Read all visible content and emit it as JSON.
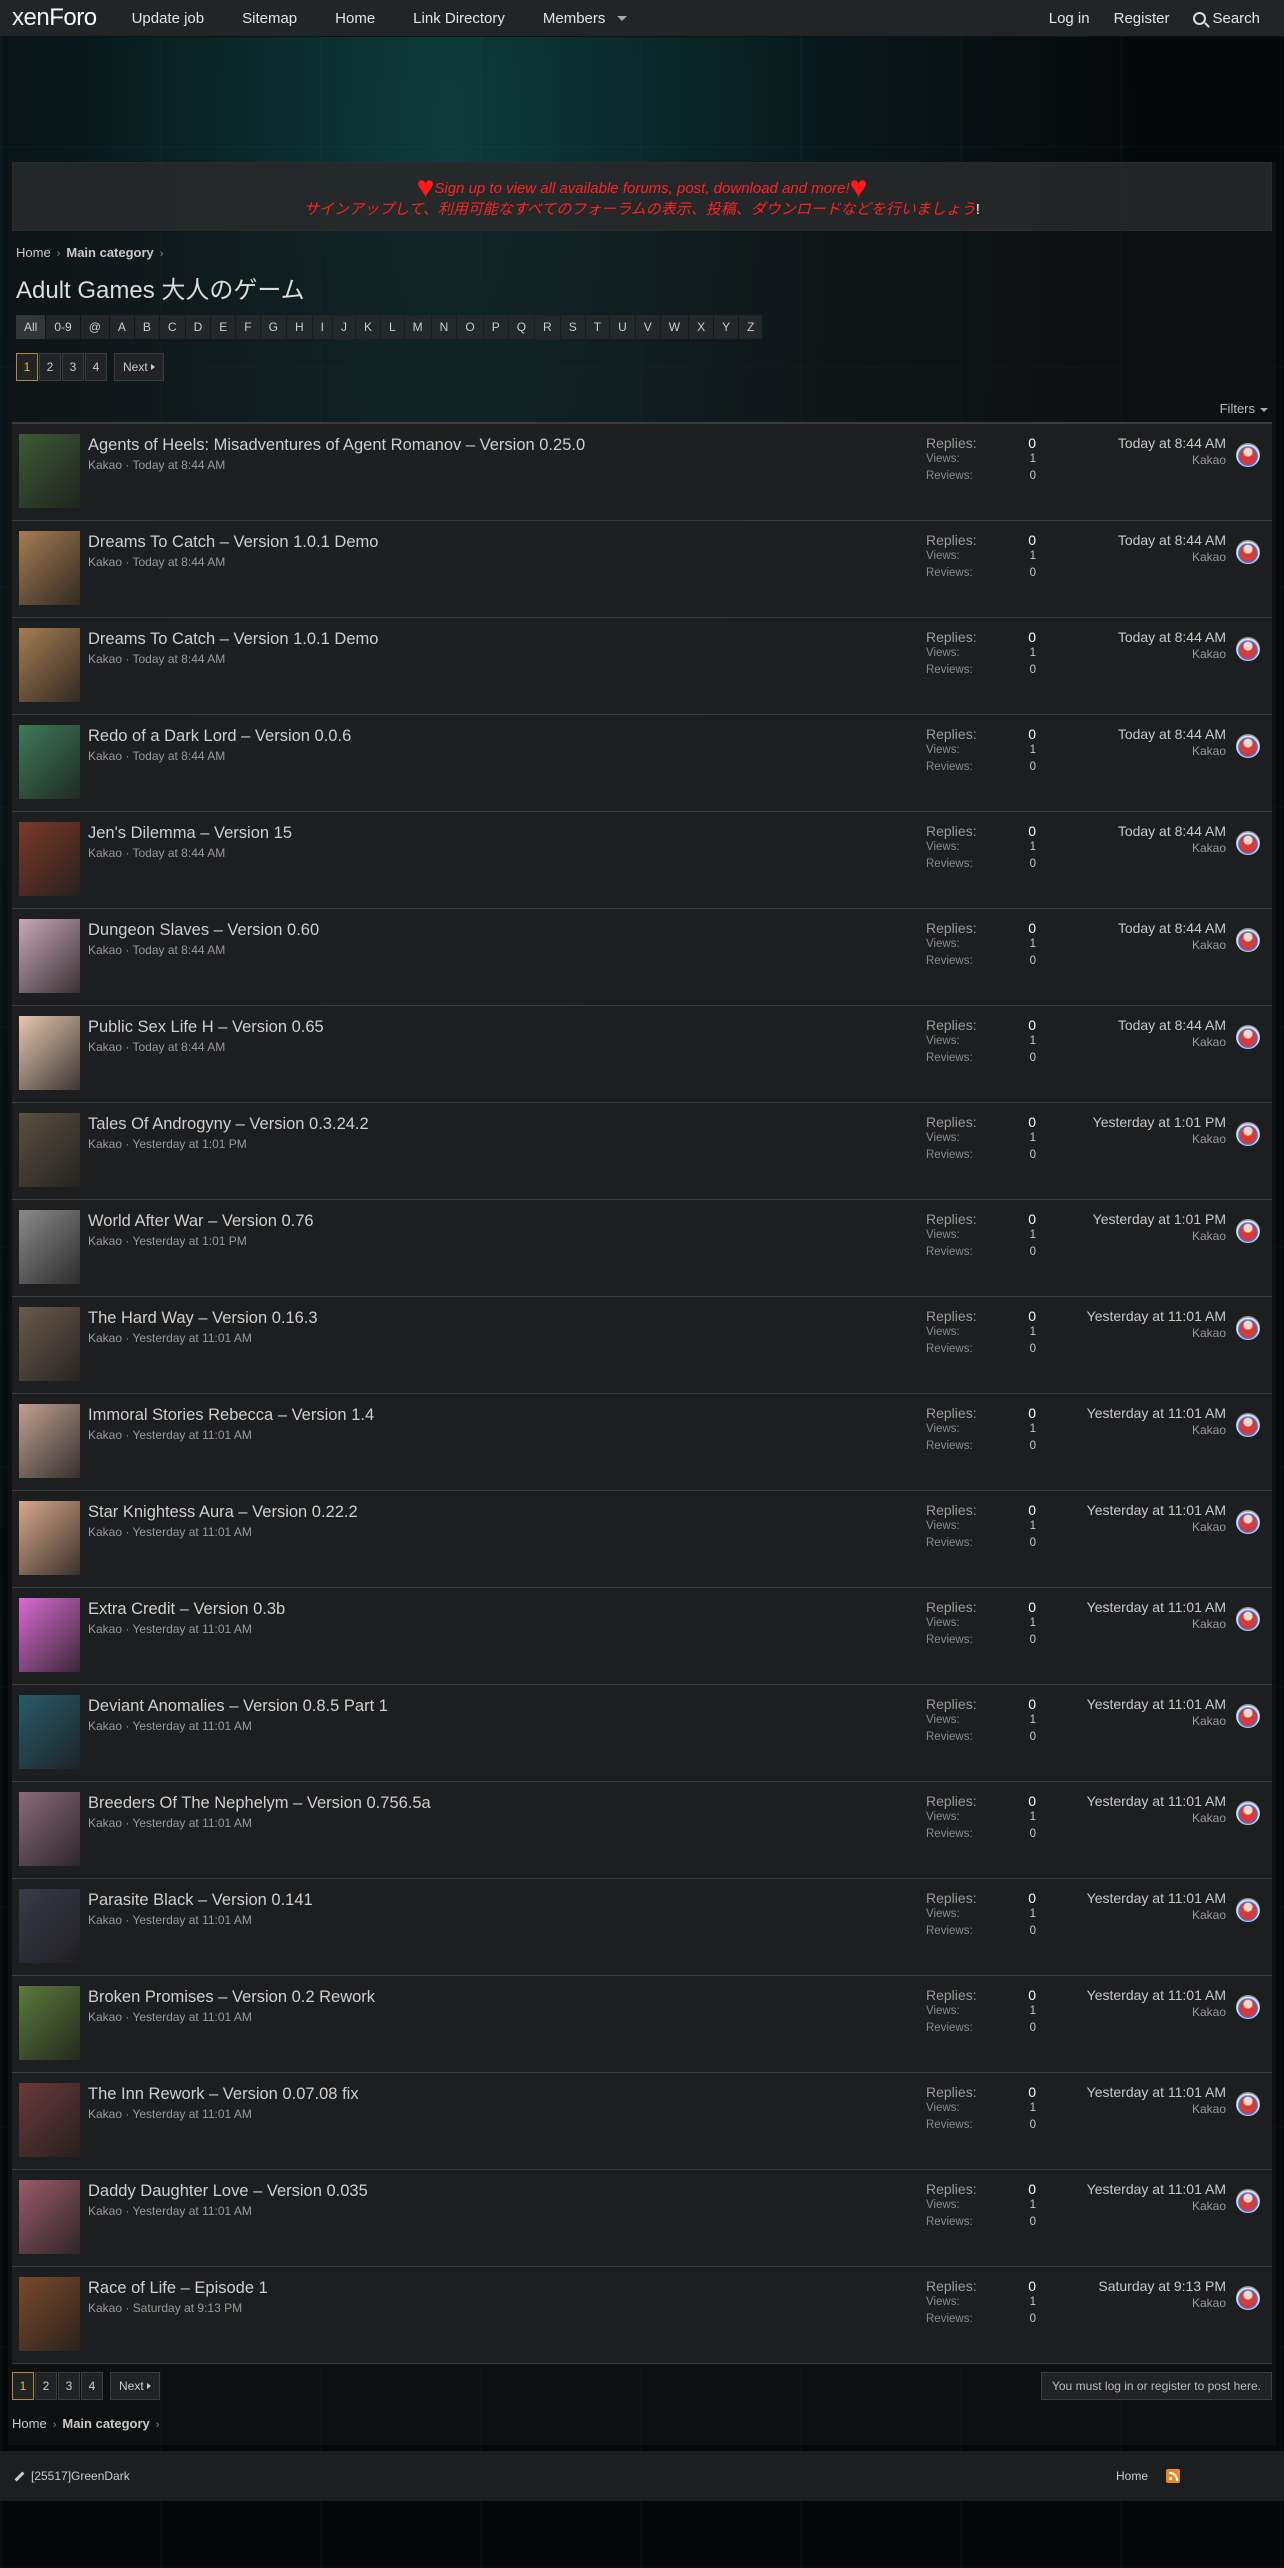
{
  "nav": {
    "logo_a": "xen",
    "logo_b": "Foro",
    "tabs": [
      "Update job",
      "Sitemap",
      "Home",
      "Link Directory",
      "Members"
    ],
    "login": "Log in",
    "register": "Register",
    "search": "Search"
  },
  "notice": {
    "line1": "Sign up to view all available forums, post, download and more!",
    "line2": "サインアップして、利用可能なすべてのフォーラムの表示、投稿、ダウンロードなどを行いましょう",
    "line2_end": "!"
  },
  "breadcrumb": {
    "home": "Home",
    "category": "Main category"
  },
  "page_title": "Adult Games 大人のゲーム",
  "letters": [
    "All",
    "0-9",
    "@",
    "A",
    "B",
    "C",
    "D",
    "E",
    "F",
    "G",
    "H",
    "I",
    "J",
    "K",
    "L",
    "M",
    "N",
    "O",
    "P",
    "Q",
    "R",
    "S",
    "T",
    "U",
    "V",
    "W",
    "X",
    "Y",
    "Z"
  ],
  "pager": {
    "pages": [
      "1",
      "2",
      "3",
      "4"
    ],
    "next": "Next"
  },
  "filters": "Filters",
  "stat_labels": {
    "replies": "Replies:",
    "views": "Views:",
    "reviews": "Reviews:"
  },
  "threads": [
    {
      "title": "Agents of Heels: Misadventures of Agent Romanov – Version 0.25.0",
      "author": "Kakao",
      "date": "Today at 8:44 AM",
      "replies": "0",
      "views": "1",
      "reviews": "0",
      "last_date": "Today at 8:44 AM",
      "last_user": "Kakao",
      "thumb_color": "#3c5a35"
    },
    {
      "title": "Dreams To Catch – Version 1.0.1 Demo",
      "author": "Kakao",
      "date": "Today at 8:44 AM",
      "replies": "0",
      "views": "1",
      "reviews": "0",
      "last_date": "Today at 8:44 AM",
      "last_user": "Kakao",
      "thumb_color": "#a67c52"
    },
    {
      "title": "Dreams To Catch – Version 1.0.1 Demo",
      "author": "Kakao",
      "date": "Today at 8:44 AM",
      "replies": "0",
      "views": "1",
      "reviews": "0",
      "last_date": "Today at 8:44 AM",
      "last_user": "Kakao",
      "thumb_color": "#a67c52"
    },
    {
      "title": "Redo of a Dark Lord – Version 0.0.6",
      "author": "Kakao",
      "date": "Today at 8:44 AM",
      "replies": "0",
      "views": "1",
      "reviews": "0",
      "last_date": "Today at 8:44 AM",
      "last_user": "Kakao",
      "thumb_color": "#3f7a5a"
    },
    {
      "title": "Jen's Dilemma – Version 15",
      "author": "Kakao",
      "date": "Today at 8:44 AM",
      "replies": "0",
      "views": "1",
      "reviews": "0",
      "last_date": "Today at 8:44 AM",
      "last_user": "Kakao",
      "thumb_color": "#7a3a2a"
    },
    {
      "title": "Dungeon Slaves – Version 0.60",
      "author": "Kakao",
      "date": "Today at 8:44 AM",
      "replies": "0",
      "views": "1",
      "reviews": "0",
      "last_date": "Today at 8:44 AM",
      "last_user": "Kakao",
      "thumb_color": "#c9a7b6"
    },
    {
      "title": "Public Sex Life H – Version 0.65",
      "author": "Kakao",
      "date": "Today at 8:44 AM",
      "replies": "0",
      "views": "1",
      "reviews": "0",
      "last_date": "Today at 8:44 AM",
      "last_user": "Kakao",
      "thumb_color": "#e6c6b0"
    },
    {
      "title": "Tales Of Androgyny – Version 0.3.24.2",
      "author": "Kakao",
      "date": "Yesterday at 1:01 PM",
      "replies": "0",
      "views": "1",
      "reviews": "0",
      "last_date": "Yesterday at 1:01 PM",
      "last_user": "Kakao",
      "thumb_color": "#5a5040"
    },
    {
      "title": "World After War – Version 0.76",
      "author": "Kakao",
      "date": "Yesterday at 1:01 PM",
      "replies": "0",
      "views": "1",
      "reviews": "0",
      "last_date": "Yesterday at 1:01 PM",
      "last_user": "Kakao",
      "thumb_color": "#8a8a8a"
    },
    {
      "title": "The Hard Way – Version 0.16.3",
      "author": "Kakao",
      "date": "Yesterday at 11:01 AM",
      "replies": "0",
      "views": "1",
      "reviews": "0",
      "last_date": "Yesterday at 11:01 AM",
      "last_user": "Kakao",
      "thumb_color": "#6a5a4a"
    },
    {
      "title": "Immoral Stories Rebecca – Version 1.4",
      "author": "Kakao",
      "date": "Yesterday at 11:01 AM",
      "replies": "0",
      "views": "1",
      "reviews": "0",
      "last_date": "Yesterday at 11:01 AM",
      "last_user": "Kakao",
      "thumb_color": "#c0a090"
    },
    {
      "title": "Star Knightess Aura – Version 0.22.2",
      "author": "Kakao",
      "date": "Yesterday at 11:01 AM",
      "replies": "0",
      "views": "1",
      "reviews": "0",
      "last_date": "Yesterday at 11:01 AM",
      "last_user": "Kakao",
      "thumb_color": "#d8a88a"
    },
    {
      "title": "Extra Credit – Version 0.3b",
      "author": "Kakao",
      "date": "Yesterday at 11:01 AM",
      "replies": "0",
      "views": "1",
      "reviews": "0",
      "last_date": "Yesterday at 11:01 AM",
      "last_user": "Kakao",
      "thumb_color": "#d86ad0"
    },
    {
      "title": "Deviant Anomalies – Version 0.8.5 Part 1",
      "author": "Kakao",
      "date": "Yesterday at 11:01 AM",
      "replies": "0",
      "views": "1",
      "reviews": "0",
      "last_date": "Yesterday at 11:01 AM",
      "last_user": "Kakao",
      "thumb_color": "#2a5a6a"
    },
    {
      "title": "Breeders Of The Nephelym – Version 0.756.5a",
      "author": "Kakao",
      "date": "Yesterday at 11:01 AM",
      "replies": "0",
      "views": "1",
      "reviews": "0",
      "last_date": "Yesterday at 11:01 AM",
      "last_user": "Kakao",
      "thumb_color": "#8a6a7a"
    },
    {
      "title": "Parasite Black – Version 0.141",
      "author": "Kakao",
      "date": "Yesterday at 11:01 AM",
      "replies": "0",
      "views": "1",
      "reviews": "0",
      "last_date": "Yesterday at 11:01 AM",
      "last_user": "Kakao",
      "thumb_color": "#3a3a4a"
    },
    {
      "title": "Broken Promises – Version 0.2 Rework",
      "author": "Kakao",
      "date": "Yesterday at 11:01 AM",
      "replies": "0",
      "views": "1",
      "reviews": "0",
      "last_date": "Yesterday at 11:01 AM",
      "last_user": "Kakao",
      "thumb_color": "#5a7a3a"
    },
    {
      "title": "The Inn Rework – Version 0.07.08 fix",
      "author": "Kakao",
      "date": "Yesterday at 11:01 AM",
      "replies": "0",
      "views": "1",
      "reviews": "0",
      "last_date": "Yesterday at 11:01 AM",
      "last_user": "Kakao",
      "thumb_color": "#6a3a3a"
    },
    {
      "title": "Daddy Daughter Love – Version 0.035",
      "author": "Kakao",
      "date": "Yesterday at 11:01 AM",
      "replies": "0",
      "views": "1",
      "reviews": "0",
      "last_date": "Yesterday at 11:01 AM",
      "last_user": "Kakao",
      "thumb_color": "#9a5a6a"
    },
    {
      "title": "Race of Life – Episode 1",
      "author": "Kakao",
      "date": "Saturday at 9:13 PM",
      "replies": "0",
      "views": "1",
      "reviews": "0",
      "last_date": "Saturday at 9:13 PM",
      "last_user": "Kakao",
      "thumb_color": "#7a4a2a"
    }
  ],
  "post_message": "You must log in or register to post here.",
  "footer": {
    "style": "[25517]GreenDark",
    "home": "Home"
  }
}
